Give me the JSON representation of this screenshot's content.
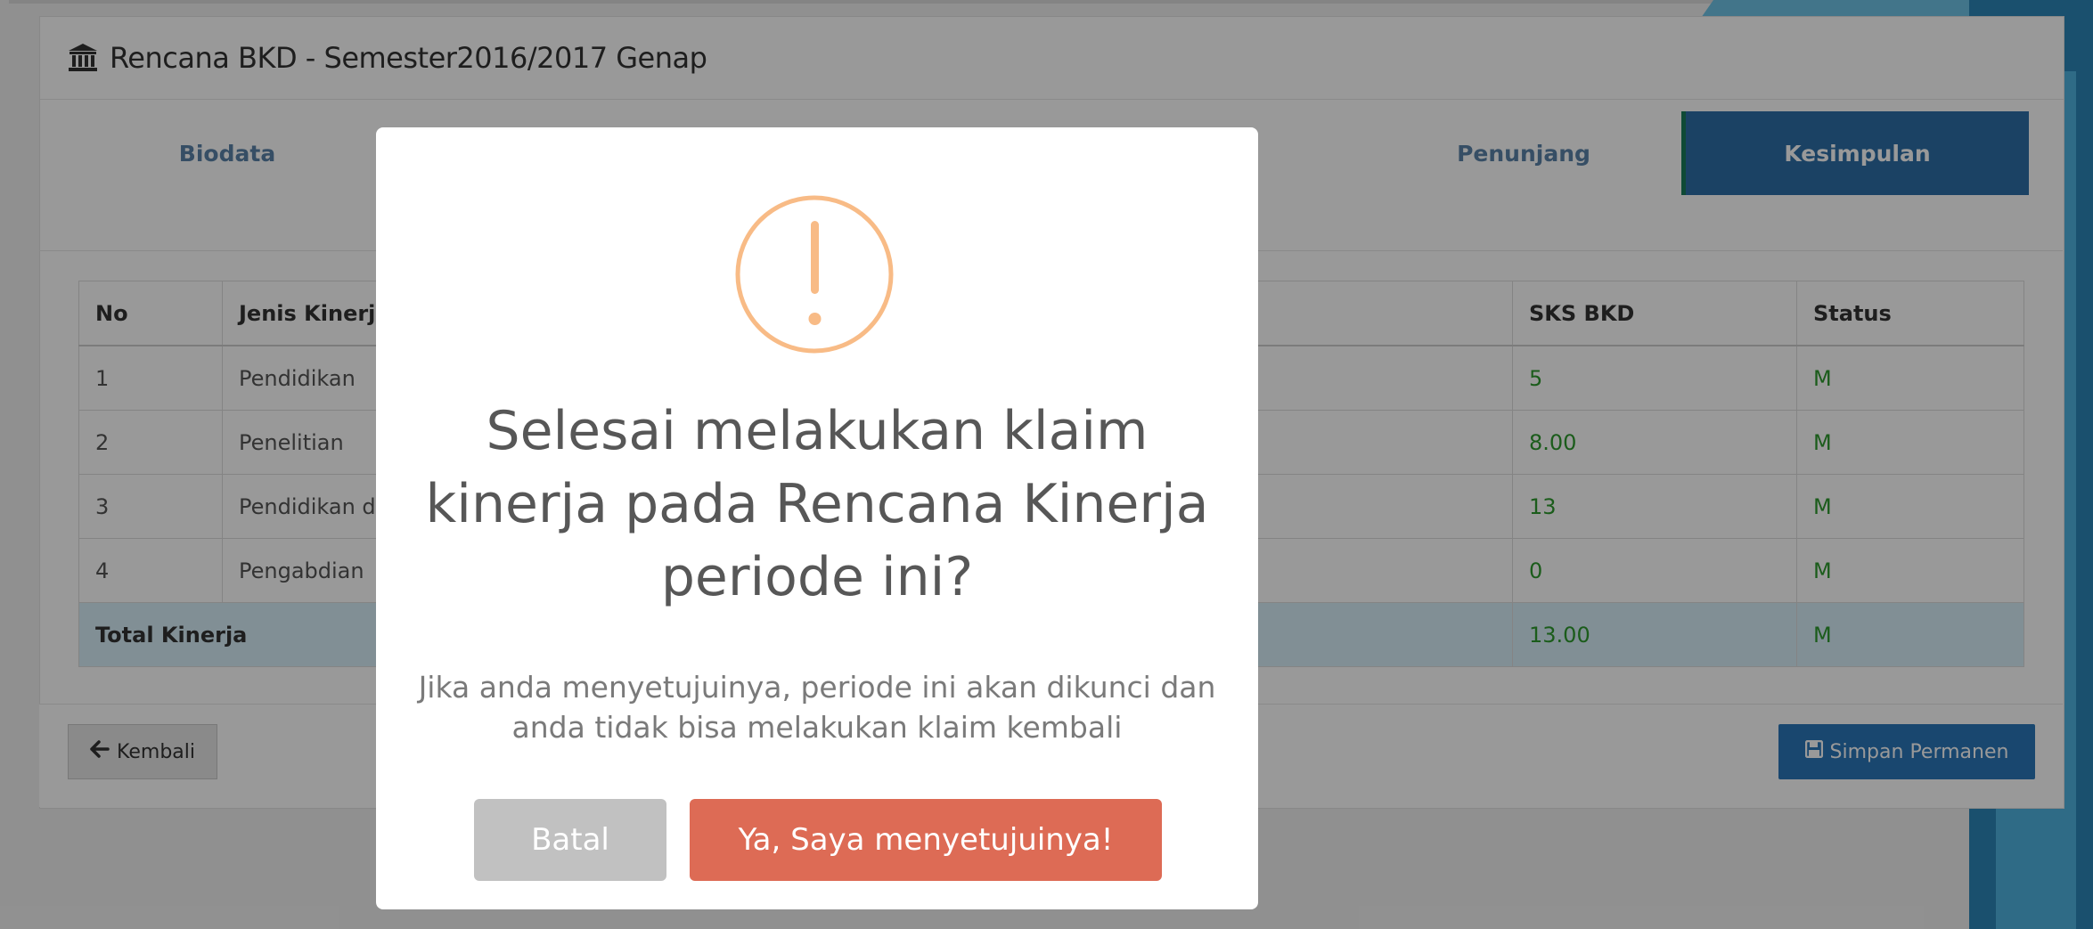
{
  "panel": {
    "title": "Rencana BKD - Semester2016/2017 Genap",
    "title_icon": "bank-icon"
  },
  "steps": [
    {
      "label": "Biodata",
      "active": false
    },
    {
      "label": "Penunjang",
      "active": false
    },
    {
      "label": "Kesimpulan",
      "active": true
    }
  ],
  "table": {
    "headers": [
      "No",
      "Jenis Kinerja",
      "SKS BKD",
      "Status"
    ],
    "rows": [
      {
        "no": "1",
        "jenis": "Pendidikan",
        "sks": "5",
        "status": "M"
      },
      {
        "no": "2",
        "jenis": "Penelitian",
        "sks": "8.00",
        "status": "M"
      },
      {
        "no": "3",
        "jenis": "Pendidikan d",
        "sks": "13",
        "status": "M"
      },
      {
        "no": "4",
        "jenis": "Pengabdian",
        "sks": "0",
        "status": "M"
      }
    ],
    "total": {
      "label": "Total Kinerja",
      "sks": "13.00",
      "status": "M"
    }
  },
  "footer": {
    "back_label": "Kembali",
    "back_icon": "arrow-left-icon",
    "save_label": "Simpan Permanen",
    "save_icon": "floppy-disk-icon"
  },
  "modal": {
    "icon": "warning-icon",
    "title": "Selesai melakukan klaim kinerja pada Rencana Kinerja periode ini?",
    "text": "Jika anda menyetujuinya, periode ini akan dikunci dan anda tidak bisa melakukan klaim kembali",
    "cancel_label": "Batal",
    "confirm_label": "Ya, Saya menyetujuinya!"
  },
  "colors": {
    "warning": "#f8bb86",
    "confirm": "#dd6b55",
    "cancel": "#c1c1c1",
    "active_step": "#2e6fa7",
    "primary_button": "#2b77b9",
    "status_green": "#2d9a2d"
  }
}
